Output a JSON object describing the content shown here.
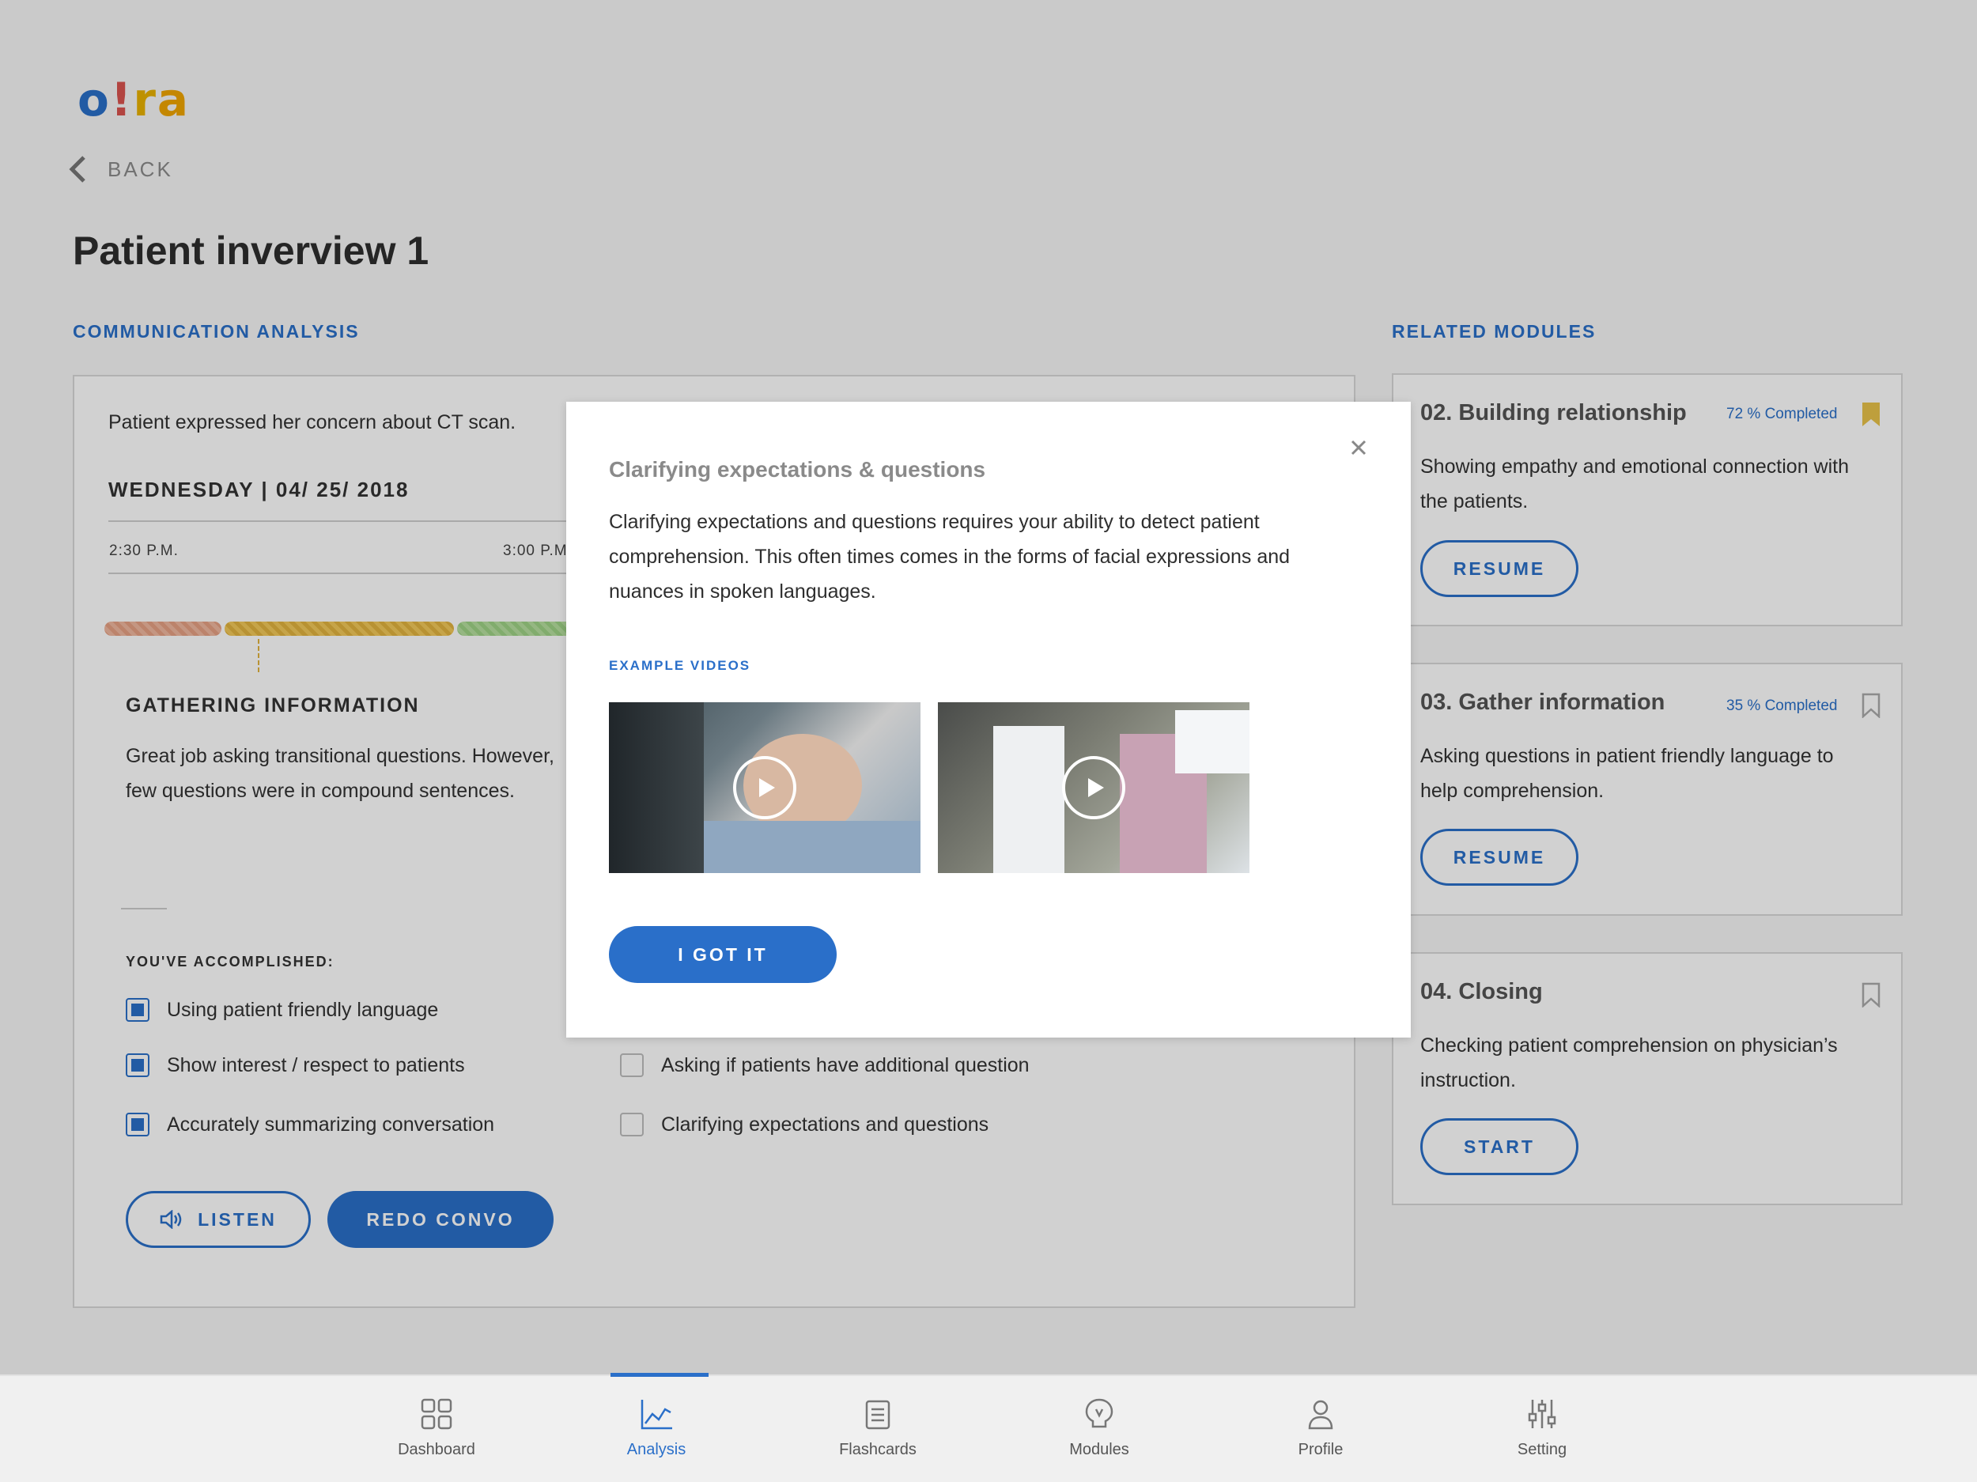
{
  "logo": {
    "o": "o",
    "dot": "!",
    "r": "r",
    "a": "a"
  },
  "nav": {
    "back_label": "BACK"
  },
  "page": {
    "title": "Patient inverview 1"
  },
  "communication": {
    "section_label": "COMMUNICATION ANALYSIS",
    "concern": "Patient expressed her concern about CT scan.",
    "date": "WEDNESDAY  |  04/ 25/ 2018",
    "time_start": "2:30 P.M.",
    "time_mid": "3:00 P.M.",
    "gathering_title": "GATHERING INFORMATION",
    "gathering_body": "Great job asking transitional questions. However, few questions were in compound sentences.",
    "accomplished_title": "YOU'VE ACCOMPLISHED:",
    "checks": [
      {
        "label": "Using patient friendly language",
        "checked": true
      },
      {
        "label": "Show interest / respect to patients",
        "checked": true
      },
      {
        "label": "Accurately summarizing conversation",
        "checked": true
      },
      {
        "label": "Asking if patients have additional question",
        "checked": false
      },
      {
        "label": "Clarifying expectations and questions",
        "checked": false
      }
    ],
    "listen_label": "LISTEN",
    "redo_label": "REDO CONVO"
  },
  "related": {
    "section_label": "RELATED MODULES",
    "modules": [
      {
        "title": "02. Building relationship",
        "percent": "72 % Completed",
        "description": "Showing empathy and emotional connection with the patients.",
        "button": "RESUME",
        "bookmarked": true
      },
      {
        "title": "03. Gather information",
        "percent": "35 % Completed",
        "description": "Asking questions in patient friendly language to help comprehension.",
        "button": "RESUME",
        "bookmarked": false
      },
      {
        "title": "04. Closing",
        "percent": "",
        "description": "Checking patient comprehension on physician’s instruction.",
        "button": "START",
        "bookmarked": false
      }
    ]
  },
  "modal": {
    "title": "Clarifying expectations & questions",
    "body": "Clarifying expectations and questions requires your ability to detect patient comprehension. This often times comes in the forms of facial expressions and nuances in spoken languages.",
    "example_label": "EXAMPLE VIDEOS",
    "got_it_label": "I GOT IT"
  },
  "tabs": [
    {
      "label": "Dashboard",
      "icon": "grid-icon",
      "active": false
    },
    {
      "label": "Analysis",
      "icon": "chart-icon",
      "active": true
    },
    {
      "label": "Flashcards",
      "icon": "cards-icon",
      "active": false
    },
    {
      "label": "Modules",
      "icon": "bulb-icon",
      "active": false
    },
    {
      "label": "Profile",
      "icon": "person-icon",
      "active": false
    },
    {
      "label": "Setting",
      "icon": "sliders-icon",
      "active": false
    }
  ],
  "colors": {
    "accent": "#2a6fc9",
    "bookmark": "#e8c34a"
  }
}
